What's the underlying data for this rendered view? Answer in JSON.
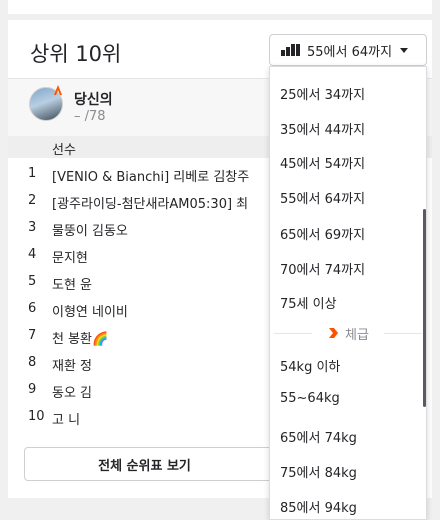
{
  "card": {
    "title": "상위 10위",
    "filter_label": "55에서 64까지"
  },
  "athlete": {
    "name": "당신의",
    "rank": "– /78"
  },
  "table": {
    "header": "선수",
    "rows": [
      {
        "rank": "1",
        "name": "[VENIO & Bianchi] 리베로 김창주"
      },
      {
        "rank": "2",
        "name": "[광주라이딩-첨단새라AM05:30] 최"
      },
      {
        "rank": "3",
        "name": "물뚱이 김동오"
      },
      {
        "rank": "4",
        "name": "문지현"
      },
      {
        "rank": "5",
        "name": "도현 윤"
      },
      {
        "rank": "6",
        "name": "이형연 네이비"
      },
      {
        "rank": "7",
        "name": "천 봉환🌈"
      },
      {
        "rank": "8",
        "name": "재환 정"
      },
      {
        "rank": "9",
        "name": "동오 김"
      },
      {
        "rank": "10",
        "name": "고 니"
      }
    ]
  },
  "full_button": "전체 순위표 보기",
  "dropdown": {
    "age_options": [
      "25에서 34까지",
      "35에서 44까지",
      "45에서 54까지",
      "55에서 64까지",
      "65에서 69까지",
      "70에서 74까지",
      "75세 이상"
    ],
    "section_label": "체급",
    "weight_options": [
      "54kg 이하",
      "55~64kg",
      "65에서 74kg",
      "75에서 84kg",
      "85에서 94kg"
    ]
  },
  "colors": {
    "accent": "#fc5200"
  }
}
